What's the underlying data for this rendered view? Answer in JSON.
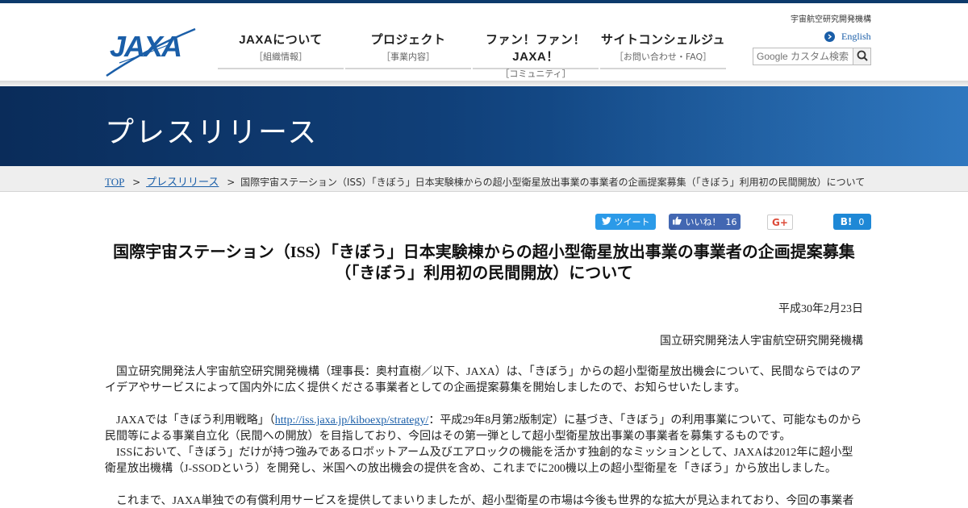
{
  "header": {
    "org_name": "宇宙航空研究開発機構",
    "english_link": "English",
    "search_placeholder": "Google カスタム検索",
    "nav": [
      {
        "main": "JAXAについて",
        "sub": "［組織情報］"
      },
      {
        "main": "プロジェクト",
        "sub": "［事業内容］"
      },
      {
        "main": "ファン！ファン！JAXA！",
        "sub": "［コミュニティ］"
      },
      {
        "main": "サイトコンシェルジュ",
        "sub": "［お問い合わせ・FAQ］"
      }
    ]
  },
  "banner": {
    "title": "プレスリリース"
  },
  "breadcrumb": {
    "top": "TOP",
    "section": "プレスリリース",
    "current": "国際宇宙ステーション（ISS）「きぼう」日本実験棟からの超小型衛星放出事業の事業者の企画提案募集（「きぼう」利用初の民間開放）について",
    "separator": ">"
  },
  "share": {
    "tweet": "ツイート",
    "like": "いいね！",
    "like_count": "16",
    "gplus": "G+",
    "hatena": "B!",
    "hatena_count": "0"
  },
  "article": {
    "title_line1": "国際宇宙ステーション（ISS）「きぼう」日本実験棟からの超小型衛星放出事業の事業者の企画提案募集",
    "title_line2": "（「きぼう」利用初の民間開放）について",
    "date": "平成30年2月23日",
    "org": "国立研究開発法人宇宙航空研究開発機構",
    "p1": "国立研究開発法人宇宙航空研究開発機構（理事長：奥村直樹／以下、JAXA）は、「きぼう」からの超小型衛星放出機会について、民間ならではのアイデアやサービスによって国内外に広く提供くださる事業者としての企画提案募集を開始しましたので、お知らせいたします。",
    "p2_before": "JAXAでは「きぼう利用戦略」（",
    "p2_link": "http://iss.jaxa.jp/kiboexp/strategy/",
    "p2_after": "：平成29年8月第2版制定）に基づき、「きぼう」の利用事業について、可能なものから民間等による事業自立化（民間への開放）を目指しており、今回はその第一弾として超小型衛星放出事業の事業者を募集するものです。",
    "p3": "ISSにおいて、「きぼう」だけが持つ強みであるロボットアーム及びエアロックの機能を活かす独創的なミッションとして、JAXAは2012年に超小型衛星放出機構（J-SSODという）を開発し、米国への放出機会の提供を含め、これまでに200機以上の超小型衛星を「きぼう」から放出しました。",
    "p4": "これまで、JAXA単独での有償利用サービスを提供してまいりましたが、超小型衛星の市場は今後も世界的な拡大が見込まれており、今回の事業者"
  },
  "colors": {
    "brand_blue": "#1a5ea8",
    "banner_dark": "#0a2c5a",
    "twitter": "#2b9ae8",
    "facebook": "#4267b2",
    "hatena": "#1e88d6",
    "gplus": "#dd4b39"
  }
}
